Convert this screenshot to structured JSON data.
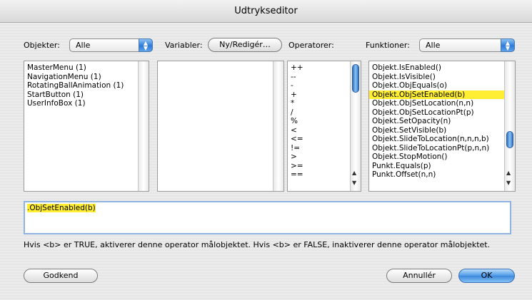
{
  "window": {
    "title": "Udtrykseditor"
  },
  "toolbar": {
    "objects_label": "Objekter:",
    "objects_value": "Alle",
    "variables_label": "Variabler:",
    "variables_button": "Ny/Redigér…",
    "operators_label": "Operatorer:",
    "functions_label": "Funktioner:",
    "functions_value": "Alle"
  },
  "objects": [
    "MasterMenu (1)",
    "NavigationMenu (1)",
    "RotatingBallAnimation (1)",
    "StartButton (1)",
    "UserInfoBox (1)"
  ],
  "variables": [],
  "operators": [
    "++",
    "--",
    "-",
    "+",
    "*",
    "/",
    "%",
    "<",
    "<=",
    "!=",
    ">",
    ">=",
    "=="
  ],
  "functions": [
    "Objekt.IsEnabled()",
    "Objekt.IsVisible()",
    "Objekt.ObjEquals(o)",
    "Objekt.ObjSetEnabled(b)",
    "Objekt.ObjSetLocation(n,n)",
    "Objekt.ObjSetLocationPt(p)",
    "Objekt.SetOpacity(n)",
    "Objekt.SetVisible(b)",
    "Objekt.SlideToLocation(n,n,n,b)",
    "Objekt.SlideToLocationPt(p,n,n)",
    "Objekt.StopMotion()",
    "Punkt.Equals(p)",
    "Punkt.Offset(n,n)"
  ],
  "selected_function_index": 3,
  "expression": {
    "text": ".ObjSetEnabled(b)"
  },
  "description": "Hvis <b> er TRUE, aktiverer denne operator målobjektet. Hvis <b> er FALSE, inaktiverer denne operator målobjektet.",
  "buttons": {
    "accept": "Godkend",
    "cancel": "Annullér",
    "ok": "OK"
  }
}
